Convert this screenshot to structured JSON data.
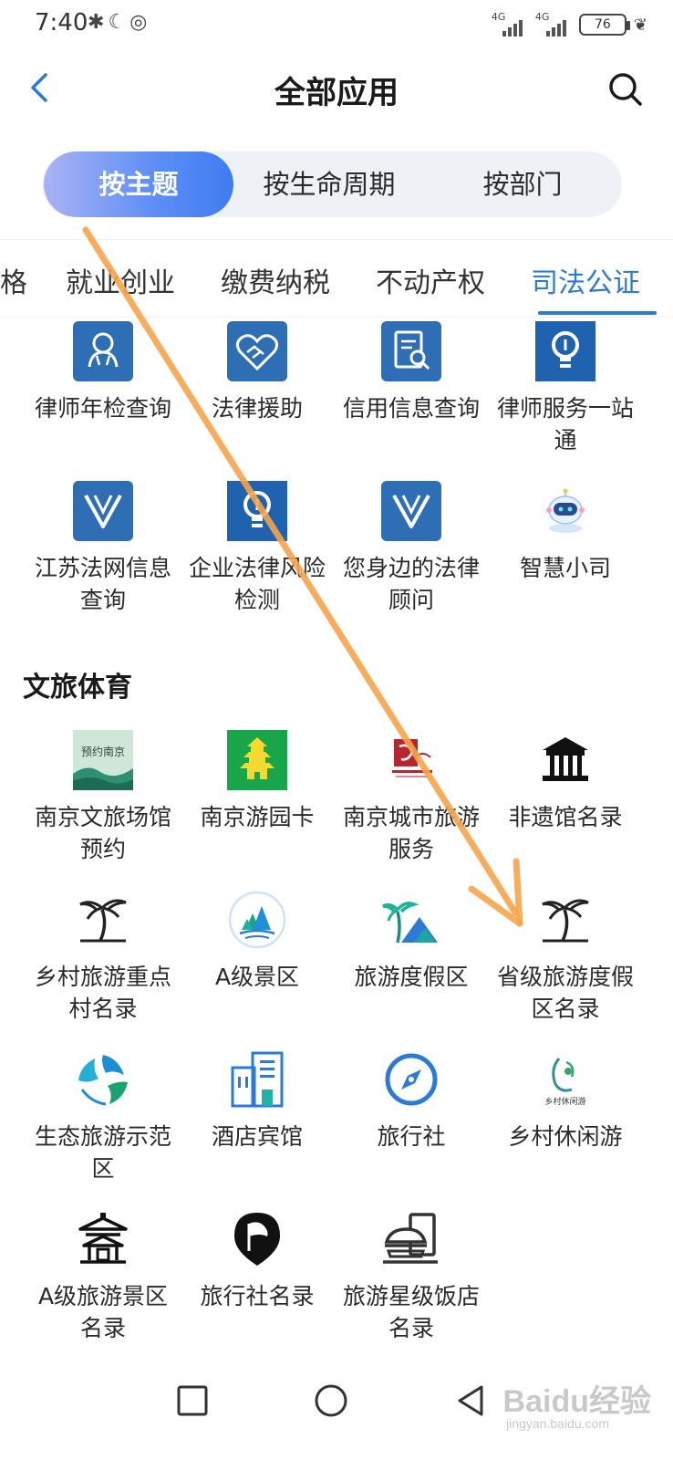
{
  "status": {
    "time": "7:40",
    "signal1": "4G",
    "signal2": "4G",
    "battery": "76"
  },
  "header": {
    "title": "全部应用"
  },
  "segments": [
    {
      "label": "按主题",
      "active": true
    },
    {
      "label": "按生命周期",
      "active": false
    },
    {
      "label": "按部门",
      "active": false
    }
  ],
  "tabs": [
    "格",
    "就业创业",
    "缴费纳税",
    "不动产权",
    "司法公证"
  ],
  "active_tab": "司法公证",
  "legal_apps": [
    {
      "label": "律师年检查询",
      "icon": "lawyer-icon"
    },
    {
      "label": "法律援助",
      "icon": "handshake-heart-icon"
    },
    {
      "label": "信用信息查询",
      "icon": "document-search-icon"
    },
    {
      "label": "律师服务一站通",
      "icon": "lightbulb-icon"
    },
    {
      "label": "江苏法网信息查询",
      "icon": "v-shield-icon"
    },
    {
      "label": "企业法律风险检测",
      "icon": "lightbulb-icon"
    },
    {
      "label": "您身边的法律顾问",
      "icon": "v-shield-icon"
    },
    {
      "label": "智慧小司",
      "icon": "robot-icon"
    }
  ],
  "culture_section": {
    "title": "文旅体育"
  },
  "culture_apps": [
    {
      "label": "南京文旅场馆预约",
      "icon": "nanjing-booking-icon",
      "icon_text": "预约南京"
    },
    {
      "label": "南京游园卡",
      "icon": "pagoda-icon"
    },
    {
      "label": "南京城市旅游服务",
      "icon": "nanjing-culture-logo-icon"
    },
    {
      "label": "非遗馆名录",
      "icon": "pavilion-icon"
    },
    {
      "label": "乡村旅游重点村名录",
      "icon": "palm-tree-icon"
    },
    {
      "label": "A级景区",
      "icon": "mountain-lake-icon"
    },
    {
      "label": "旅游度假区",
      "icon": "palm-mountain-icon"
    },
    {
      "label": "省级旅游度假区名录",
      "icon": "palm-tree-icon"
    },
    {
      "label": "生态旅游示范区",
      "icon": "eco-leaves-icon"
    },
    {
      "label": "酒店宾馆",
      "icon": "hotel-building-icon"
    },
    {
      "label": "旅行社",
      "icon": "compass-icon"
    },
    {
      "label": "乡村休闲游",
      "icon": "rural-leisure-icon",
      "icon_text": "乡村休闲游"
    },
    {
      "label": "A级旅游景区名录",
      "icon": "temple-icon"
    },
    {
      "label": "旅行社名录",
      "icon": "flag-pin-icon"
    },
    {
      "label": "旅游星级饭店名录",
      "icon": "food-plate-icon"
    }
  ],
  "watermark": {
    "text": "Baidu经验",
    "sub": "jingyan.baidu.com"
  },
  "colors": {
    "accent": "#2a7bd8",
    "arrow": "#f7a54a",
    "icon_blue": "#2e6eb5"
  }
}
